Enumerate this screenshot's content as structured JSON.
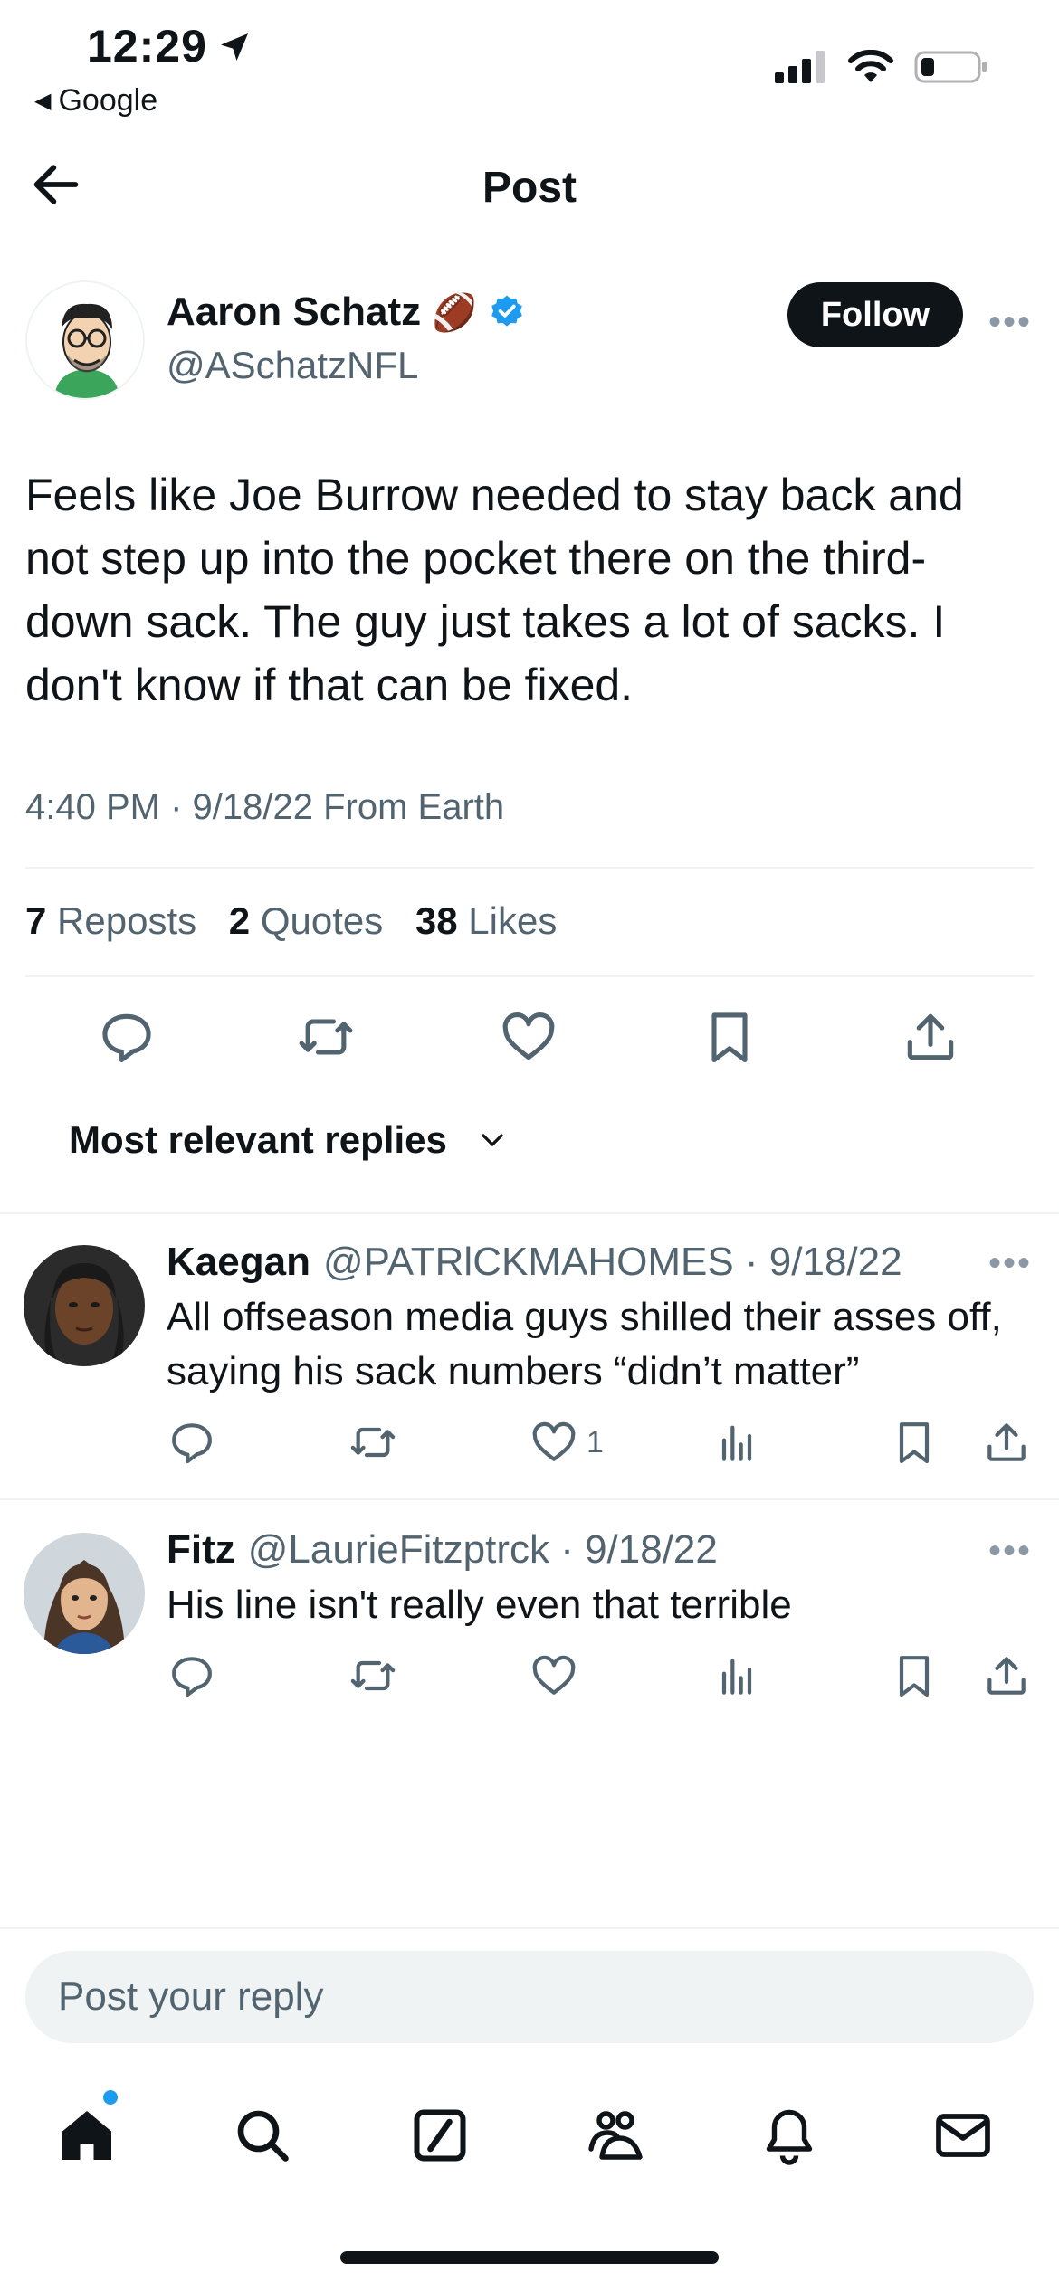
{
  "status_bar": {
    "time": "12:29",
    "back_app": "Google"
  },
  "header": {
    "title": "Post"
  },
  "post": {
    "author_name": "Aaron Schatz",
    "author_emoji": "🏈",
    "author_handle": "@ASchatzNFL",
    "follow_label": "Follow",
    "text": "Feels like Joe Burrow needed to stay back and not step up into the pocket there on the third-down sack. The guy just takes a lot of sacks. I don't know if that can be fixed.",
    "meta": "4:40 PM · 9/18/22 From Earth",
    "stats": {
      "reposts_count": "7",
      "reposts_label": "Reposts",
      "quotes_count": "2",
      "quotes_label": "Quotes",
      "likes_count": "38",
      "likes_label": "Likes"
    }
  },
  "sort": {
    "label": "Most relevant replies"
  },
  "replies": [
    {
      "name": "Kaegan",
      "handle_date": "@PATRlCKMAHOMES · 9/18/22",
      "text": "All offseason media guys shilled their asses off, saying his sack numbers “didn’t matter”",
      "likes": "1"
    },
    {
      "name": "Fitz",
      "handle_date": "@LaurieFitzptrck · 9/18/22",
      "text": "His line isn't really even that terrible",
      "likes": ""
    }
  ],
  "reply_box": {
    "placeholder": "Post your reply"
  },
  "colors": {
    "text": "#0f1419",
    "secondary": "#536471",
    "divider": "#eff3f4",
    "verified": "#1d9bf0",
    "notification_dot": "#1d9bf0"
  }
}
